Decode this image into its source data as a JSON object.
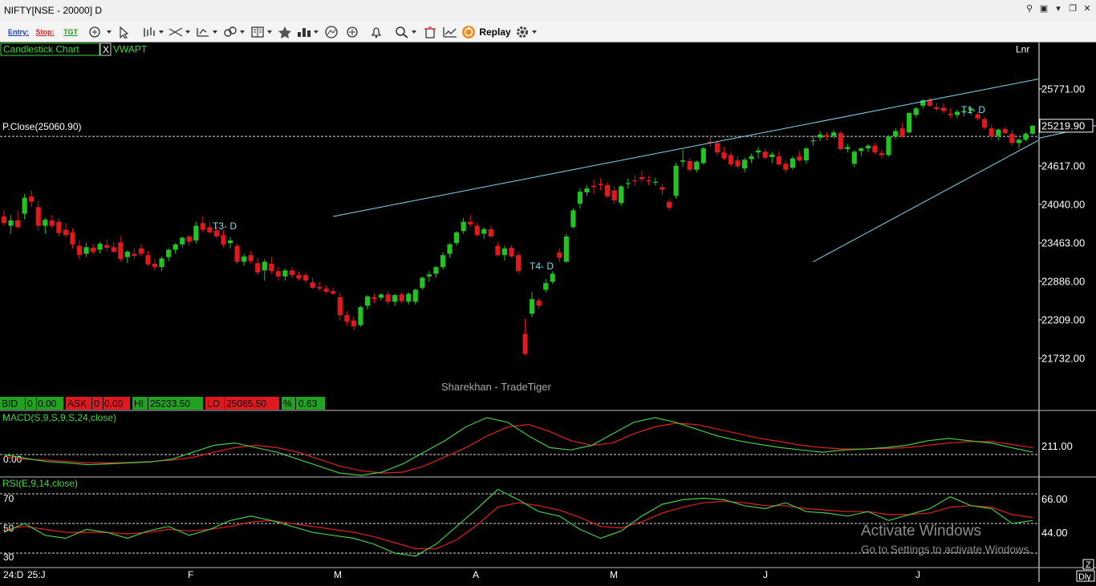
{
  "window": {
    "title": "NIFTY[NSE - 20000] D"
  },
  "toolbar": {
    "entry_label": "Entry:",
    "stop_label": "Stop:",
    "tgt_label": "TGT",
    "replay_label": "Replay"
  },
  "chart_header": {
    "chart_type_label": "Candlestick Chart",
    "close_glyph": "X",
    "vwap_label": "VWAPT",
    "scale_label": "Lnr",
    "prev_close_label": "P.Close(25060.90)",
    "watermark": "Sharekhan - TradeTiger",
    "t1_label": "T1- D",
    "t3_label": "T3- D",
    "t4_label": "T4- D"
  },
  "quote_bar": {
    "bid_label": "BID",
    "bid_value": "0",
    "bid_price": "0.00",
    "ask_label": "ASK",
    "ask_value": "0",
    "ask_price": "0.00",
    "hi_label": "HI",
    "hi_value": "25233.50",
    "lo_label": "LO",
    "lo_value": "25085.50",
    "pct_label": "%",
    "pct_value": "0.63"
  },
  "macd_panel": {
    "label": "MACD(S,9,S,9,S,24,close)",
    "zero_label": "0.00",
    "right_label": "211.00"
  },
  "rsi_panel": {
    "label": "RSI(E,9,14,close)",
    "left_labels": [
      "70",
      "50",
      "30"
    ],
    "right_labels": [
      "66.00",
      "44.00"
    ]
  },
  "x_axis": {
    "labels": [
      "24:D",
      "25:J",
      "F",
      "M",
      "A",
      "M",
      "J",
      "J"
    ],
    "z_label": "Z",
    "dly_label": "Dly"
  },
  "overlay": {
    "activate_title": "Activate Windows",
    "activate_sub": "Go to Settings to activate Windows."
  },
  "colors": {
    "up": "#22c322",
    "down": "#e0191e",
    "channel": "#7fd9ee",
    "macd_line": "#44c944",
    "signal_line": "#e02020",
    "header_green": "#3dd83d"
  },
  "chart_data": {
    "type": "candlestick",
    "y_ticks": [
      25771,
      25219.9,
      24617,
      24040,
      23463,
      22886,
      22309,
      21732
    ],
    "ylim": [
      21732,
      25771
    ],
    "prev_close": 25060.9,
    "current_price": "25219.90",
    "candles": [
      [
        23860,
        23960,
        23720,
        23760
      ],
      [
        23720,
        23880,
        23600,
        23800
      ],
      [
        23800,
        23950,
        23680,
        23700
      ],
      [
        23900,
        24200,
        23820,
        24140
      ],
      [
        24160,
        24250,
        24000,
        24080
      ],
      [
        24000,
        24090,
        23650,
        23720
      ],
      [
        23720,
        23840,
        23600,
        23810
      ],
      [
        23800,
        23880,
        23680,
        23720
      ],
      [
        23780,
        23840,
        23560,
        23610
      ],
      [
        23660,
        23760,
        23540,
        23580
      ],
      [
        23620,
        23680,
        23380,
        23440
      ],
      [
        23420,
        23500,
        23220,
        23280
      ],
      [
        23300,
        23460,
        23250,
        23400
      ],
      [
        23390,
        23440,
        23290,
        23330
      ],
      [
        23360,
        23480,
        23300,
        23450
      ],
      [
        23430,
        23520,
        23340,
        23390
      ],
      [
        23400,
        23480,
        23310,
        23330
      ],
      [
        23470,
        23560,
        23180,
        23220
      ],
      [
        23250,
        23360,
        23160,
        23330
      ],
      [
        23300,
        23380,
        23220,
        23270
      ],
      [
        23380,
        23450,
        23260,
        23300
      ],
      [
        23280,
        23340,
        23120,
        23140
      ],
      [
        23150,
        23220,
        23050,
        23100
      ],
      [
        23100,
        23260,
        23040,
        23230
      ],
      [
        23250,
        23380,
        23190,
        23360
      ],
      [
        23360,
        23460,
        23300,
        23440
      ],
      [
        23440,
        23560,
        23400,
        23540
      ],
      [
        23560,
        23580,
        23430,
        23480
      ],
      [
        23500,
        23780,
        23450,
        23720
      ],
      [
        23760,
        23860,
        23620,
        23660
      ],
      [
        23700,
        23780,
        23600,
        23620
      ],
      [
        23650,
        23710,
        23520,
        23560
      ],
      [
        23580,
        23650,
        23400,
        23440
      ],
      [
        23460,
        23550,
        23380,
        23500
      ],
      [
        23420,
        23460,
        23140,
        23180
      ],
      [
        23180,
        23300,
        23120,
        23260
      ],
      [
        23280,
        23340,
        23150,
        23190
      ],
      [
        23160,
        23240,
        22980,
        23020
      ],
      [
        23050,
        23220,
        22900,
        23180
      ],
      [
        23150,
        23250,
        23000,
        23040
      ],
      [
        23040,
        23110,
        22900,
        22960
      ],
      [
        22960,
        23080,
        22900,
        23050
      ],
      [
        23050,
        23100,
        22930,
        22980
      ],
      [
        22980,
        23030,
        22900,
        22930
      ],
      [
        22980,
        23020,
        22860,
        22900
      ],
      [
        22870,
        22940,
        22770,
        22790
      ],
      [
        22800,
        22880,
        22740,
        22780
      ],
      [
        22780,
        22830,
        22710,
        22730
      ],
      [
        22740,
        22790,
        22680,
        22700
      ],
      [
        22650,
        22720,
        22300,
        22380
      ],
      [
        22380,
        22440,
        22220,
        22280
      ],
      [
        22300,
        22360,
        22150,
        22210
      ],
      [
        22230,
        22520,
        22200,
        22500
      ],
      [
        22520,
        22680,
        22460,
        22660
      ],
      [
        22650,
        22700,
        22560,
        22620
      ],
      [
        22640,
        22710,
        22600,
        22690
      ],
      [
        22690,
        22740,
        22540,
        22580
      ],
      [
        22580,
        22700,
        22520,
        22680
      ],
      [
        22690,
        22720,
        22560,
        22590
      ],
      [
        22580,
        22720,
        22540,
        22700
      ],
      [
        22580,
        22780,
        22540,
        22760
      ],
      [
        22790,
        22960,
        22760,
        22940
      ],
      [
        22960,
        23040,
        22880,
        22990
      ],
      [
        23000,
        23120,
        22940,
        23100
      ],
      [
        23100,
        23320,
        23060,
        23280
      ],
      [
        23300,
        23460,
        23240,
        23440
      ],
      [
        23460,
        23640,
        23420,
        23620
      ],
      [
        23640,
        23840,
        23600,
        23780
      ],
      [
        23780,
        23880,
        23700,
        23740
      ],
      [
        23720,
        23760,
        23560,
        23580
      ],
      [
        23600,
        23700,
        23520,
        23670
      ],
      [
        23670,
        23720,
        23540,
        23560
      ],
      [
        23420,
        23470,
        23260,
        23280
      ],
      [
        23280,
        23420,
        23200,
        23380
      ],
      [
        23390,
        23430,
        23250,
        23260
      ],
      [
        23280,
        23330,
        23010,
        23040
      ],
      [
        22100,
        22320,
        21780,
        21800
      ],
      [
        22400,
        22730,
        22350,
        22620
      ],
      [
        22600,
        22640,
        22470,
        22520
      ],
      [
        22760,
        22920,
        22720,
        22860
      ],
      [
        22880,
        23040,
        22850,
        23000
      ],
      [
        23320,
        23380,
        23170,
        23240
      ],
      [
        23180,
        23600,
        23160,
        23560
      ],
      [
        23700,
        23980,
        23680,
        23950
      ],
      [
        24050,
        24280,
        23980,
        24230
      ],
      [
        24220,
        24330,
        24170,
        24280
      ],
      [
        24320,
        24410,
        24200,
        24300
      ],
      [
        24350,
        24430,
        24250,
        24330
      ],
      [
        24330,
        24370,
        24130,
        24160
      ],
      [
        24250,
        24310,
        24050,
        24100
      ],
      [
        24060,
        24330,
        24020,
        24310
      ],
      [
        24360,
        24430,
        24280,
        24360
      ],
      [
        24400,
        24480,
        24320,
        24390
      ],
      [
        24450,
        24550,
        24380,
        24420
      ],
      [
        24400,
        24470,
        24330,
        24390
      ],
      [
        24380,
        24440,
        24320,
        24380
      ],
      [
        24300,
        24350,
        24180,
        24260
      ],
      [
        24080,
        24120,
        23950,
        23990
      ],
      [
        24170,
        24660,
        24130,
        24620
      ],
      [
        24680,
        24860,
        24600,
        24700
      ],
      [
        24690,
        24740,
        24530,
        24560
      ],
      [
        24560,
        24700,
        24520,
        24680
      ],
      [
        24660,
        24900,
        24640,
        24880
      ],
      [
        24980,
        25070,
        24900,
        24960
      ],
      [
        24960,
        25000,
        24770,
        24820
      ],
      [
        24820,
        24900,
        24700,
        24730
      ],
      [
        24780,
        24830,
        24600,
        24640
      ],
      [
        24700,
        24760,
        24580,
        24610
      ],
      [
        24580,
        24740,
        24520,
        24710
      ],
      [
        24720,
        24800,
        24660,
        24760
      ],
      [
        24820,
        24900,
        24730,
        24850
      ],
      [
        24830,
        24880,
        24720,
        24740
      ],
      [
        24750,
        24830,
        24660,
        24790
      ],
      [
        24760,
        24840,
        24620,
        24640
      ],
      [
        24650,
        24700,
        24520,
        24560
      ],
      [
        24590,
        24760,
        24560,
        24730
      ],
      [
        24760,
        24840,
        24680,
        24700
      ],
      [
        24700,
        24900,
        24650,
        24880
      ],
      [
        24990,
        25070,
        24920,
        25000
      ],
      [
        25040,
        25140,
        24990,
        25090
      ],
      [
        25080,
        25120,
        25000,
        25060
      ],
      [
        25070,
        25160,
        25030,
        25120
      ],
      [
        25110,
        25140,
        24850,
        24870
      ],
      [
        24870,
        24950,
        24820,
        24900
      ],
      [
        24650,
        24850,
        24600,
        24830
      ],
      [
        24840,
        24900,
        24760,
        24880
      ],
      [
        24880,
        24940,
        24820,
        24920
      ],
      [
        24920,
        24960,
        24790,
        24820
      ],
      [
        24810,
        24860,
        24730,
        24780
      ],
      [
        24780,
        25080,
        24760,
        25060
      ],
      [
        25060,
        25180,
        25020,
        25140
      ],
      [
        25180,
        25260,
        25040,
        25060
      ],
      [
        25120,
        25430,
        25100,
        25410
      ],
      [
        25380,
        25500,
        25340,
        25480
      ],
      [
        25520,
        25620,
        25480,
        25600
      ],
      [
        25600,
        25640,
        25500,
        25520
      ],
      [
        25500,
        25560,
        25440,
        25470
      ],
      [
        25490,
        25560,
        25410,
        25440
      ],
      [
        25400,
        25480,
        25340,
        25380
      ],
      [
        25380,
        25460,
        25330,
        25430
      ],
      [
        25420,
        25470,
        25360,
        25440
      ],
      [
        25450,
        25500,
        25380,
        25480
      ],
      [
        25390,
        25420,
        25300,
        25330
      ],
      [
        25320,
        25360,
        25160,
        25190
      ],
      [
        25180,
        25240,
        25020,
        25060
      ],
      [
        25070,
        25180,
        25000,
        25160
      ],
      [
        25170,
        25200,
        25090,
        25110
      ],
      [
        25100,
        25160,
        24920,
        24960
      ],
      [
        24960,
        25040,
        24880,
        25010
      ],
      [
        25010,
        25120,
        24990,
        25100
      ],
      [
        25100,
        25233,
        25085,
        25219
      ]
    ],
    "trendlines": [
      {
        "name": "T3- D",
        "from_index": 48,
        "from_price": 23860,
        "to_index": 179,
        "to_price": 25920
      },
      {
        "name": "T4- D",
        "from_index": 118,
        "from_price": 23180,
        "to_index": 179,
        "to_price": 25000
      },
      {
        "name": "T1- D",
        "from_index": 170,
        "from_price": 25470,
        "to_index": 179,
        "to_price": 25030
      }
    ],
    "macd": {
      "zero": 0,
      "macd_line": [
        0,
        -8,
        -15,
        -18,
        -22,
        -20,
        -18,
        -16,
        -10,
        5,
        20,
        25,
        15,
        5,
        -10,
        -25,
        -40,
        -45,
        -38,
        -20,
        5,
        30,
        60,
        80,
        70,
        40,
        15,
        10,
        20,
        45,
        70,
        80,
        70,
        55,
        40,
        30,
        22,
        15,
        10,
        5,
        10,
        12,
        15,
        20,
        30,
        35,
        30,
        25,
        15,
        5
      ],
      "signal_line": [
        -5,
        -10,
        -12,
        -15,
        -18,
        -18,
        -17,
        -15,
        -12,
        -6,
        5,
        15,
        20,
        15,
        5,
        -10,
        -25,
        -35,
        -40,
        -38,
        -25,
        -5,
        15,
        40,
        60,
        65,
        50,
        30,
        20,
        25,
        45,
        60,
        68,
        65,
        55,
        45,
        35,
        28,
        20,
        15,
        12,
        12,
        13,
        15,
        20,
        25,
        28,
        28,
        22,
        15
      ]
    },
    "rsi": {
      "ylim": [
        26,
        78
      ],
      "levels": [
        70,
        50,
        30
      ],
      "rsi_line": [
        44,
        50,
        42,
        40,
        46,
        44,
        40,
        45,
        48,
        42,
        46,
        52,
        55,
        52,
        48,
        44,
        42,
        40,
        36,
        30,
        28,
        36,
        48,
        60,
        73,
        66,
        58,
        55,
        46,
        40,
        45,
        55,
        63,
        66,
        67,
        66,
        62,
        60,
        64,
        58,
        57,
        55,
        58,
        52,
        56,
        60,
        68,
        62,
        60,
        50,
        52
      ],
      "signal_line": [
        46,
        48,
        46,
        44,
        44,
        44,
        43,
        44,
        46,
        45,
        46,
        48,
        51,
        52,
        50,
        48,
        46,
        44,
        41,
        37,
        33,
        33,
        39,
        49,
        61,
        64,
        62,
        59,
        54,
        48,
        47,
        51,
        57,
        61,
        64,
        65,
        64,
        62,
        62,
        60,
        59,
        58,
        58,
        56,
        56,
        57,
        61,
        62,
        61,
        56,
        54
      ]
    }
  }
}
